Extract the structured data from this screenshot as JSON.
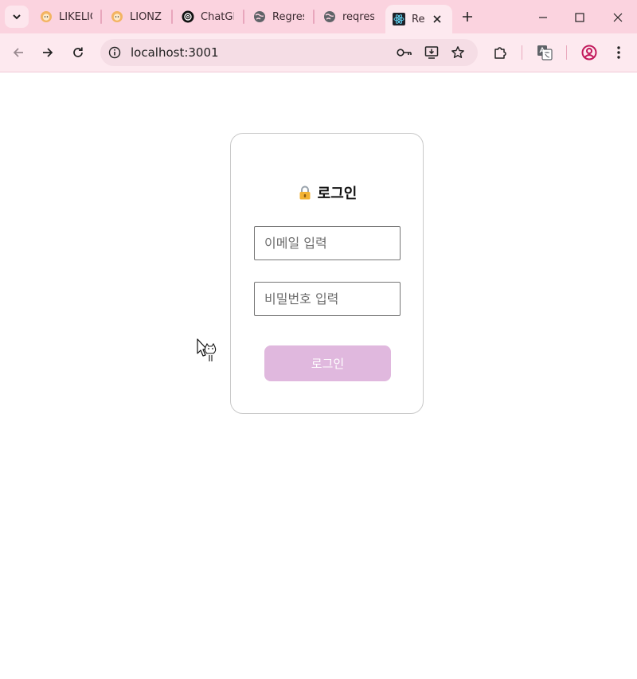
{
  "browser": {
    "tabs": [
      {
        "label": "LIKELIC",
        "icon": "lion-icon"
      },
      {
        "label": "LIONZ",
        "icon": "lion-icon"
      },
      {
        "label": "ChatGP",
        "icon": "openai-icon"
      },
      {
        "label": "Regres",
        "icon": "globe-icon"
      },
      {
        "label": "reqres.",
        "icon": "globe-icon"
      },
      {
        "label": "Re",
        "icon": "react-icon",
        "active": true
      }
    ],
    "url": "localhost:3001"
  },
  "login": {
    "title": "로그인",
    "email_placeholder": "이메일 입력",
    "password_placeholder": "비밀번호 입력",
    "submit_label": "로그인"
  },
  "colors": {
    "tabstrip": "#fbd3df",
    "toolbar": "#fde9ef",
    "button": "#e0b8de"
  }
}
